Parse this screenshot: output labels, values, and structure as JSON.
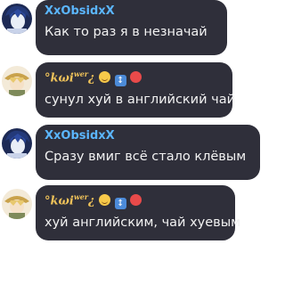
{
  "messages": [
    {
      "author": "XxObsidxX",
      "text": "Как то раз я в незначай",
      "author_style": "blue",
      "avatar_icon": "anime-boy-avatar"
    },
    {
      "author": "°kωi",
      "author_sup": "wer",
      "author_suffix": "¿",
      "text": "сунул хуй в английский чай",
      "author_style": "gold",
      "avatar_icon": "anime-hat-avatar"
    },
    {
      "author": "XxObsidxX",
      "text": "Сразу вмиг всё стало клёвым",
      "author_style": "blue",
      "avatar_icon": "anime-boy-avatar"
    },
    {
      "author": "°kωi",
      "author_sup": "wer",
      "author_suffix": "¿",
      "text": "хуй английским, чай хуевым",
      "author_style": "gold",
      "avatar_icon": "anime-hat-avatar"
    }
  ],
  "colors": {
    "bubble": "#2f2f3a",
    "name_blue": "#5bb6ff",
    "name_gold": "#f0c35a",
    "text": "#f2f2f2"
  }
}
